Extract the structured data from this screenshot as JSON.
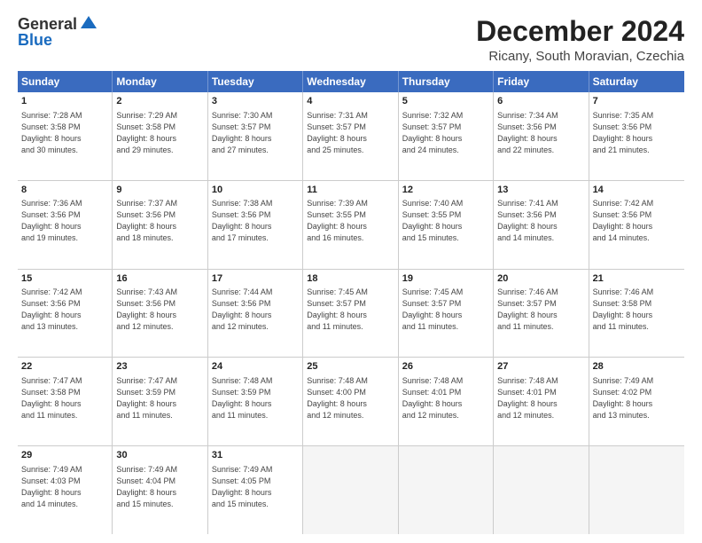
{
  "header": {
    "logo_general": "General",
    "logo_blue": "Blue",
    "main_title": "December 2024",
    "subtitle": "Ricany, South Moravian, Czechia"
  },
  "calendar": {
    "days_of_week": [
      "Sunday",
      "Monday",
      "Tuesday",
      "Wednesday",
      "Thursday",
      "Friday",
      "Saturday"
    ],
    "weeks": [
      [
        {
          "day": "1",
          "info": "Sunrise: 7:28 AM\nSunset: 3:58 PM\nDaylight: 8 hours\nand 30 minutes."
        },
        {
          "day": "2",
          "info": "Sunrise: 7:29 AM\nSunset: 3:58 PM\nDaylight: 8 hours\nand 29 minutes."
        },
        {
          "day": "3",
          "info": "Sunrise: 7:30 AM\nSunset: 3:57 PM\nDaylight: 8 hours\nand 27 minutes."
        },
        {
          "day": "4",
          "info": "Sunrise: 7:31 AM\nSunset: 3:57 PM\nDaylight: 8 hours\nand 25 minutes."
        },
        {
          "day": "5",
          "info": "Sunrise: 7:32 AM\nSunset: 3:57 PM\nDaylight: 8 hours\nand 24 minutes."
        },
        {
          "day": "6",
          "info": "Sunrise: 7:34 AM\nSunset: 3:56 PM\nDaylight: 8 hours\nand 22 minutes."
        },
        {
          "day": "7",
          "info": "Sunrise: 7:35 AM\nSunset: 3:56 PM\nDaylight: 8 hours\nand 21 minutes."
        }
      ],
      [
        {
          "day": "8",
          "info": "Sunrise: 7:36 AM\nSunset: 3:56 PM\nDaylight: 8 hours\nand 19 minutes."
        },
        {
          "day": "9",
          "info": "Sunrise: 7:37 AM\nSunset: 3:56 PM\nDaylight: 8 hours\nand 18 minutes."
        },
        {
          "day": "10",
          "info": "Sunrise: 7:38 AM\nSunset: 3:56 PM\nDaylight: 8 hours\nand 17 minutes."
        },
        {
          "day": "11",
          "info": "Sunrise: 7:39 AM\nSunset: 3:55 PM\nDaylight: 8 hours\nand 16 minutes."
        },
        {
          "day": "12",
          "info": "Sunrise: 7:40 AM\nSunset: 3:55 PM\nDaylight: 8 hours\nand 15 minutes."
        },
        {
          "day": "13",
          "info": "Sunrise: 7:41 AM\nSunset: 3:56 PM\nDaylight: 8 hours\nand 14 minutes."
        },
        {
          "day": "14",
          "info": "Sunrise: 7:42 AM\nSunset: 3:56 PM\nDaylight: 8 hours\nand 14 minutes."
        }
      ],
      [
        {
          "day": "15",
          "info": "Sunrise: 7:42 AM\nSunset: 3:56 PM\nDaylight: 8 hours\nand 13 minutes."
        },
        {
          "day": "16",
          "info": "Sunrise: 7:43 AM\nSunset: 3:56 PM\nDaylight: 8 hours\nand 12 minutes."
        },
        {
          "day": "17",
          "info": "Sunrise: 7:44 AM\nSunset: 3:56 PM\nDaylight: 8 hours\nand 12 minutes."
        },
        {
          "day": "18",
          "info": "Sunrise: 7:45 AM\nSunset: 3:57 PM\nDaylight: 8 hours\nand 11 minutes."
        },
        {
          "day": "19",
          "info": "Sunrise: 7:45 AM\nSunset: 3:57 PM\nDaylight: 8 hours\nand 11 minutes."
        },
        {
          "day": "20",
          "info": "Sunrise: 7:46 AM\nSunset: 3:57 PM\nDaylight: 8 hours\nand 11 minutes."
        },
        {
          "day": "21",
          "info": "Sunrise: 7:46 AM\nSunset: 3:58 PM\nDaylight: 8 hours\nand 11 minutes."
        }
      ],
      [
        {
          "day": "22",
          "info": "Sunrise: 7:47 AM\nSunset: 3:58 PM\nDaylight: 8 hours\nand 11 minutes."
        },
        {
          "day": "23",
          "info": "Sunrise: 7:47 AM\nSunset: 3:59 PM\nDaylight: 8 hours\nand 11 minutes."
        },
        {
          "day": "24",
          "info": "Sunrise: 7:48 AM\nSunset: 3:59 PM\nDaylight: 8 hours\nand 11 minutes."
        },
        {
          "day": "25",
          "info": "Sunrise: 7:48 AM\nSunset: 4:00 PM\nDaylight: 8 hours\nand 12 minutes."
        },
        {
          "day": "26",
          "info": "Sunrise: 7:48 AM\nSunset: 4:01 PM\nDaylight: 8 hours\nand 12 minutes."
        },
        {
          "day": "27",
          "info": "Sunrise: 7:48 AM\nSunset: 4:01 PM\nDaylight: 8 hours\nand 12 minutes."
        },
        {
          "day": "28",
          "info": "Sunrise: 7:49 AM\nSunset: 4:02 PM\nDaylight: 8 hours\nand 13 minutes."
        }
      ],
      [
        {
          "day": "29",
          "info": "Sunrise: 7:49 AM\nSunset: 4:03 PM\nDaylight: 8 hours\nand 14 minutes."
        },
        {
          "day": "30",
          "info": "Sunrise: 7:49 AM\nSunset: 4:04 PM\nDaylight: 8 hours\nand 15 minutes."
        },
        {
          "day": "31",
          "info": "Sunrise: 7:49 AM\nSunset: 4:05 PM\nDaylight: 8 hours\nand 15 minutes."
        },
        {
          "day": "",
          "info": ""
        },
        {
          "day": "",
          "info": ""
        },
        {
          "day": "",
          "info": ""
        },
        {
          "day": "",
          "info": ""
        }
      ]
    ]
  }
}
